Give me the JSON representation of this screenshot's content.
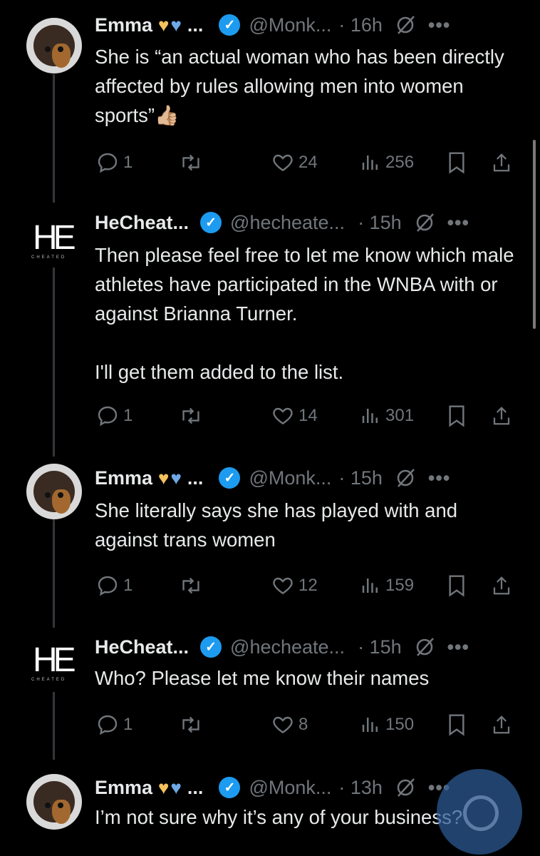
{
  "tweets": [
    {
      "author": "Emma",
      "hearts": [
        "💛",
        "💙"
      ],
      "ellipsis": "...",
      "handle": "@Monk...",
      "time": "· 16h",
      "text": "She is “an actual woman who has been directly affected by rules allowing men into women sports”👍🏼",
      "replies": "1",
      "likes": "24",
      "views": "256",
      "avatar": "bird-avatar"
    },
    {
      "author": "HeCheat...",
      "handle": "@hecheate...",
      "time": "· 15h",
      "text_lines": [
        "Then please feel free to let me know which male athletes have participated in the WNBA with or against Brianna Turner.",
        "I'll get them added to the list."
      ],
      "replies": "1",
      "likes": "14",
      "views": "301",
      "avatar": "he-cheated-logo",
      "logo_text": "HE",
      "logo_subtext": "CHEATED"
    },
    {
      "author": "Emma",
      "hearts": [
        "💛",
        "💙"
      ],
      "ellipsis": "...",
      "handle": "@Monk...",
      "time": "· 15h",
      "text": "She literally says she has played with and against trans women",
      "replies": "1",
      "likes": "12",
      "views": "159",
      "avatar": "bird-avatar"
    },
    {
      "author": "HeCheat...",
      "handle": "@hecheate...",
      "time": "· 15h",
      "text": "Who? Please let me know their names",
      "replies": "1",
      "likes": "8",
      "views": "150",
      "avatar": "he-cheated-logo",
      "logo_text": "HE",
      "logo_subtext": "CHEATED"
    },
    {
      "author": "Emma",
      "hearts": [
        "💛",
        "💙"
      ],
      "ellipsis": "...",
      "handle": "@Monk...",
      "time": "· 13h",
      "text": "I’m not sure why it’s any of your business?",
      "avatar": "bird-avatar"
    }
  ],
  "verified_mark": "✓",
  "more_label": "•••",
  "colors": {
    "background": "#000000",
    "text": "#e7e9ea",
    "muted": "#71767b",
    "verified": "#1d9bf0"
  }
}
